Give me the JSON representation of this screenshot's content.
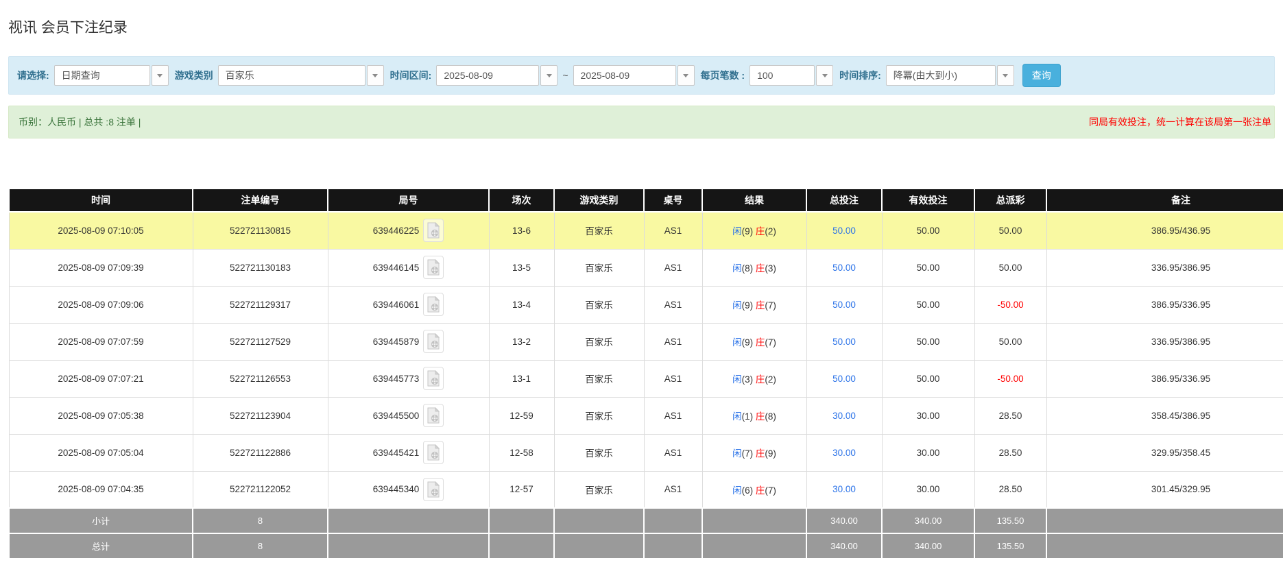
{
  "page": {
    "title": "视讯 会员下注纪录"
  },
  "toolbar": {
    "fields": [
      {
        "label": "请选择:",
        "value": "日期查询"
      },
      {
        "label": "游戏类别",
        "value": "百家乐"
      },
      {
        "label": "时间区间:",
        "value": "2025-08-09",
        "separator": "~",
        "value2": "2025-08-09"
      },
      {
        "label": "每页笔数 :",
        "value": "100"
      },
      {
        "label": "时间排序:",
        "value": "降冪(由大到小)"
      }
    ],
    "search_label": "查询"
  },
  "summary_bar": {
    "left_text": "币别：人民币 | 总共 :8 注单 |",
    "right_text": "同局有效投注，统一计算在该局第一张注单"
  },
  "icons": {
    "round_video": "video-file-icon",
    "dropdown": "chevron-down-icon"
  },
  "table": {
    "columns": [
      "时间",
      "注单编号",
      "局号",
      "场次",
      "游戏类别",
      "桌号",
      "结果",
      "总投注",
      "有效投注",
      "总派彩",
      "备注"
    ],
    "rows": [
      {
        "time": "2025-08-09 07:10:05",
        "bet_id": "522721130815",
        "round_id": "639446225",
        "session": "13-6",
        "game": "百家乐",
        "table_no": "AS1",
        "result": {
          "player": "闲(9)",
          "banker": "庄(2)"
        },
        "total_bet": "50.00",
        "valid_bet": "50.00",
        "payout": "50.00",
        "remark": "386.95/436.95",
        "highlight": true
      },
      {
        "time": "2025-08-09 07:09:39",
        "bet_id": "522721130183",
        "round_id": "639446145",
        "session": "13-5",
        "game": "百家乐",
        "table_no": "AS1",
        "result": {
          "player": "闲(8)",
          "banker": "庄(3)"
        },
        "total_bet": "50.00",
        "valid_bet": "50.00",
        "payout": "50.00",
        "remark": "336.95/386.95",
        "highlight": false
      },
      {
        "time": "2025-08-09 07:09:06",
        "bet_id": "522721129317",
        "round_id": "639446061",
        "session": "13-4",
        "game": "百家乐",
        "table_no": "AS1",
        "result": {
          "player": "闲(9)",
          "banker": "庄(7)"
        },
        "total_bet": "50.00",
        "valid_bet": "50.00",
        "payout": "-50.00",
        "remark": "386.95/336.95",
        "highlight": false
      },
      {
        "time": "2025-08-09 07:07:59",
        "bet_id": "522721127529",
        "round_id": "639445879",
        "session": "13-2",
        "game": "百家乐",
        "table_no": "AS1",
        "result": {
          "player": "闲(9)",
          "banker": "庄(7)"
        },
        "total_bet": "50.00",
        "valid_bet": "50.00",
        "payout": "50.00",
        "remark": "336.95/386.95",
        "highlight": false
      },
      {
        "time": "2025-08-09 07:07:21",
        "bet_id": "522721126553",
        "round_id": "639445773",
        "session": "13-1",
        "game": "百家乐",
        "table_no": "AS1",
        "result": {
          "player": "闲(3)",
          "banker": "庄(2)"
        },
        "total_bet": "50.00",
        "valid_bet": "50.00",
        "payout": "-50.00",
        "remark": "386.95/336.95",
        "highlight": false
      },
      {
        "time": "2025-08-09 07:05:38",
        "bet_id": "522721123904",
        "round_id": "639445500",
        "session": "12-59",
        "game": "百家乐",
        "table_no": "AS1",
        "result": {
          "player": "闲(1)",
          "banker": "庄(8)"
        },
        "total_bet": "30.00",
        "valid_bet": "30.00",
        "payout": "28.50",
        "remark": "358.45/386.95",
        "highlight": false
      },
      {
        "time": "2025-08-09 07:05:04",
        "bet_id": "522721122886",
        "round_id": "639445421",
        "session": "12-58",
        "game": "百家乐",
        "table_no": "AS1",
        "result": {
          "player": "闲(7)",
          "banker": "庄(9)"
        },
        "total_bet": "30.00",
        "valid_bet": "30.00",
        "payout": "28.50",
        "remark": "329.95/358.45",
        "highlight": false
      },
      {
        "time": "2025-08-09 07:04:35",
        "bet_id": "522721122052",
        "round_id": "639445340",
        "session": "12-57",
        "game": "百家乐",
        "table_no": "AS1",
        "result": {
          "player": "闲(6)",
          "banker": "庄(7)"
        },
        "total_bet": "30.00",
        "valid_bet": "30.00",
        "payout": "28.50",
        "remark": "301.45/329.95",
        "highlight": false
      }
    ],
    "footer": [
      {
        "label": "小计",
        "count": "8",
        "total_bet": "340.00",
        "valid_bet": "340.00",
        "payout": "135.50"
      },
      {
        "label": "总计",
        "count": "8",
        "total_bet": "340.00",
        "valid_bet": "340.00",
        "payout": "135.50"
      }
    ]
  },
  "colors": {
    "toolbar-bg": "#d9edf7",
    "alert-bg": "#dff0d8",
    "btn-blue": "#49b0dd",
    "header-bg": "#151515",
    "footer-bg": "#9a9a9a",
    "highlight": "#f9f9a2",
    "link-blue": "#2a72e8",
    "red": "#ff0000"
  }
}
